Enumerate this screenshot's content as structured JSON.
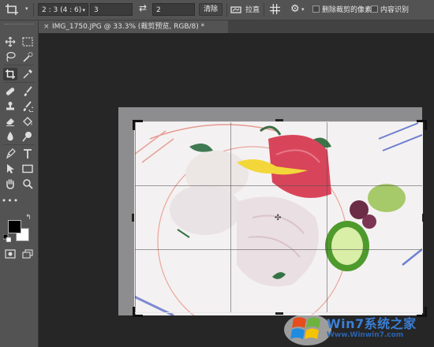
{
  "options_bar": {
    "ratio_select": "2 : 3 (4 : 6)",
    "width_value": "3",
    "height_value": "2",
    "clear_button": "清除",
    "straighten_label": "拉直",
    "delete_cropped_label": "删除裁剪的像素",
    "content_aware_label": "内容识别"
  },
  "document_tab": {
    "title": "IMG_1750.JPG @ 33.3% (裁剪预览, RGB/8) *"
  },
  "toolbar": {
    "tools": [
      "move-tool",
      "marquee-tool",
      "lasso-tool",
      "quick-select-tool",
      "crop-tool",
      "eyedropper-tool",
      "healing-brush-tool",
      "brush-tool",
      "clone-stamp-tool",
      "history-brush-tool",
      "eraser-tool",
      "paint-bucket-tool",
      "blur-tool",
      "dodge-tool",
      "pen-tool",
      "type-tool",
      "path-select-tool",
      "rectangle-tool",
      "hand-tool",
      "zoom-tool",
      "edit-toolbar"
    ]
  },
  "colors": {
    "foreground": "#000000",
    "background": "#ffffff",
    "panel": "#535353",
    "canvas_bg": "#262626"
  },
  "watermark": {
    "brand": "Win7系统之家",
    "url": "Www.Winwin7.com"
  }
}
